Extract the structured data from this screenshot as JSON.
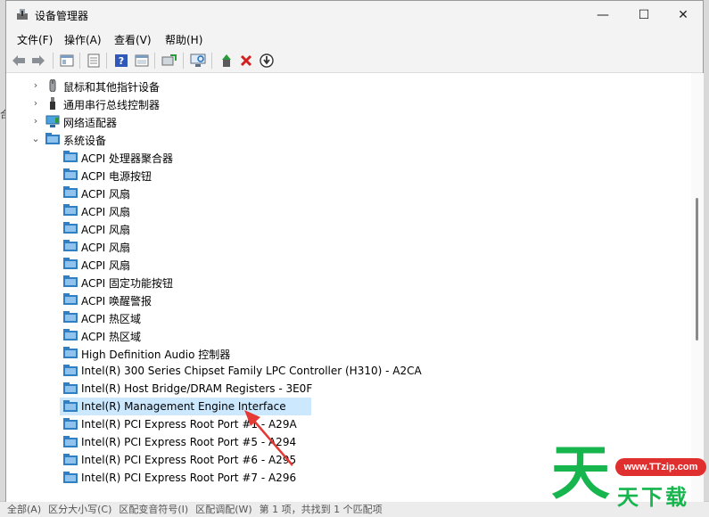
{
  "window": {
    "title": "设备管理器",
    "controls": {
      "minimize": "—",
      "maximize": "☐",
      "close": "✕"
    }
  },
  "menu": [
    "文件(F)",
    "操作(A)",
    "查看(V)",
    "帮助(H)"
  ],
  "toolbar": {
    "icons": [
      "back-arrow-icon",
      "forward-arrow-icon",
      "properties-icon",
      "document-icon",
      "help-icon",
      "view-icon",
      "update-driver-icon",
      "scan-hardware-icon",
      "enable-device-icon",
      "uninstall-icon",
      "download-icon"
    ]
  },
  "tree": {
    "categories": [
      {
        "label": "鼠标和其他指针设备",
        "expanded": false
      },
      {
        "label": "通用串行总线控制器",
        "expanded": false
      },
      {
        "label": "网络适配器",
        "expanded": false
      },
      {
        "label": "系统设备",
        "expanded": true
      }
    ],
    "devices": [
      "ACPI 处理器聚合器",
      "ACPI 电源按钮",
      "ACPI 风扇",
      "ACPI 风扇",
      "ACPI 风扇",
      "ACPI 风扇",
      "ACPI 风扇",
      "ACPI 固定功能按钮",
      "ACPI 唤醒警报",
      "ACPI 热区域",
      "ACPI 热区域",
      "High Definition Audio 控制器",
      "Intel(R) 300 Series Chipset Family LPC Controller (H310) - A2CA",
      "Intel(R) Host Bridge/DRAM Registers - 3E0F",
      "Intel(R) Management Engine Interface",
      "Intel(R) PCI Express Root Port #1 - A29A",
      "Intel(R) PCI Express Root Port #5 - A294",
      "Intel(R) PCI Express Root Port #6 - A295",
      "Intel(R) PCI Express Root Port #7 - A296"
    ],
    "selected_index": 14
  },
  "watermark": {
    "big": "天",
    "url": "www.TTzip.com",
    "sub": "天下载"
  },
  "background": {
    "left_fragment": "合",
    "bottom_fragments": [
      "全部(A)",
      "区分大小写(C)",
      "区配变音符号(I)",
      "区配调配(W)",
      "第 1 项，共找到 1 个匹配项"
    ]
  },
  "colors": {
    "selection": "#cce8ff",
    "arrow": "#e53935",
    "watermark_green": "#17b54d",
    "watermark_red": "#e02f2f"
  }
}
